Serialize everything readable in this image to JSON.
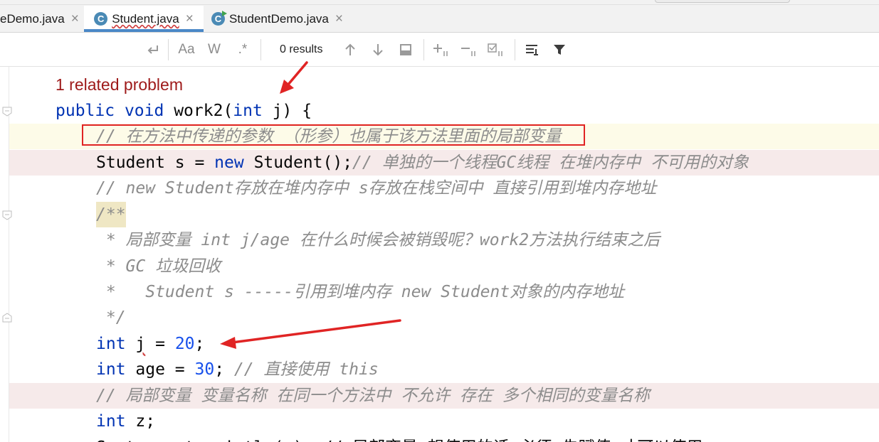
{
  "tabs": [
    {
      "label": "eDemo.java",
      "close": "×",
      "active": false
    },
    {
      "label": "Student.java",
      "close": "×",
      "active": true,
      "icon_letter": "C"
    },
    {
      "label": "StudentDemo.java",
      "close": "×",
      "active": false,
      "icon_letter": "C"
    }
  ],
  "search_toolbar": {
    "results_text": "0 results",
    "icons": [
      "new-line-icon",
      "match-case-icon",
      "whole-words-icon",
      "regex-icon",
      "prev-occurrence-icon",
      "next-occurrence-icon",
      "filter-search-results-icon",
      "add-selection-icon",
      "remove-selection-icon",
      "select-all-occurrences-icon",
      "open-in-find-window-icon",
      "filter-icon"
    ],
    "match_case_label": "Aa",
    "whole_words_label": "W",
    "regex_label": ".*"
  },
  "editor": {
    "problem_hint": "1 related problem",
    "lines": {
      "l1_kw1": "public",
      "l1_kw2": "void",
      "l1_name": "work2(",
      "l1_kw3": "int",
      "l1_rest": " j) {",
      "l2_comment": "// 在方法中传递的参数 （形参）也属于该方法里面的局部变量",
      "l3_code1": "Student s = ",
      "l3_kw": "new",
      "l3_code2": " Student();",
      "l3_comment": "// 单独的一个线程GC线程 在堆内存中 不可用的对象",
      "l4_comment": "// new Student存放在堆内存中 s存放在栈空间中 直接引用到堆内存地址",
      "l5_doc_open": "/**",
      "l6_doc": " * 局部变量 int j/age 在什么时候会被销毁呢？work2方法执行结束之后",
      "l7_doc": " * GC 垃圾回收",
      "l8_doc": " *   Student s -----引用到堆内存 new Student对象的内存地址",
      "l9_doc_close": " */",
      "l10_kw": "int",
      "l10_var": "j",
      "l10_eq": " = ",
      "l10_num": "20",
      "l10_end": ";",
      "l11_kw": "int",
      "l11_eq": " age = ",
      "l11_num": "30",
      "l11_end": "; ",
      "l11_comment": "// 直接使用 this",
      "l12_comment": "// 局部变量 变量名称 在同一个方法中 不允许 存在 多个相同的变量名称",
      "l13_kw": "int",
      "l13_rest": " z;",
      "l14_partial": "System.out.println(z); // 局部变量 想使用的话 必须 先赋值 才可以使用"
    }
  },
  "colors": {
    "keyword": "#0033b3",
    "number": "#1750eb",
    "comment": "#8c8c8c",
    "problem": "#9e1a1a",
    "annotation_red": "#e02424",
    "active_tab_underline": "#4a88c7"
  }
}
